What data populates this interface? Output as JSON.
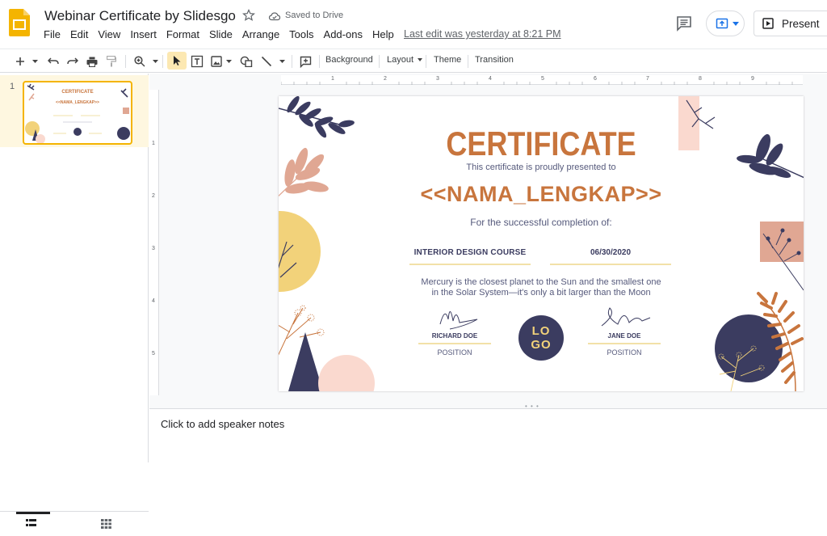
{
  "app": {
    "title": "Webinar Certificate by Slidesgo",
    "saved_status": "Saved to Drive",
    "last_edit": "Last edit was yesterday at 8:21 PM",
    "brand_color": "#f4b400"
  },
  "menu": [
    "File",
    "Edit",
    "View",
    "Insert",
    "Format",
    "Slide",
    "Arrange",
    "Tools",
    "Add-ons",
    "Help"
  ],
  "header": {
    "present_label": "Present"
  },
  "toolbar": {
    "background_label": "Background",
    "layout_label": "Layout",
    "theme_label": "Theme",
    "transition_label": "Transition"
  },
  "filmstrip": {
    "slide_number": "1",
    "thumb_title": "CERTIFICATE",
    "thumb_name": "<<NAMA_LENGKAP>>"
  },
  "ruler": {
    "h_ticks": [
      "1",
      "2",
      "3",
      "4",
      "5",
      "6",
      "7",
      "8",
      "9"
    ],
    "v_ticks": [
      "1",
      "2",
      "3",
      "4",
      "5"
    ]
  },
  "slide": {
    "title": "CERTIFICATE",
    "subtitle": "This certificate is proudly presented to",
    "recipient": "<<NAMA_LENGKAP>>",
    "completion": "For the successful completion of:",
    "course": "INTERIOR DESIGN COURSE",
    "date": "06/30/2020",
    "description_line1": "Mercury is the closest planet to the Sun and the smallest one",
    "description_line2": "in the Solar System—it's only a bit larger than the Moon",
    "signer_left_name": "RICHARD DOE",
    "signer_left_position": "POSITION",
    "signer_right_name": "JANE DOE",
    "signer_right_position": "POSITION",
    "logo_line1": "LO",
    "logo_line2": "GO",
    "colors": {
      "accent_orange": "#c8753d",
      "navy": "#3b3c60",
      "mustard": "#f2d27a",
      "peach": "#fad9cf",
      "salmon": "#e0a793"
    }
  },
  "notes": {
    "placeholder": "Click to add speaker notes"
  }
}
